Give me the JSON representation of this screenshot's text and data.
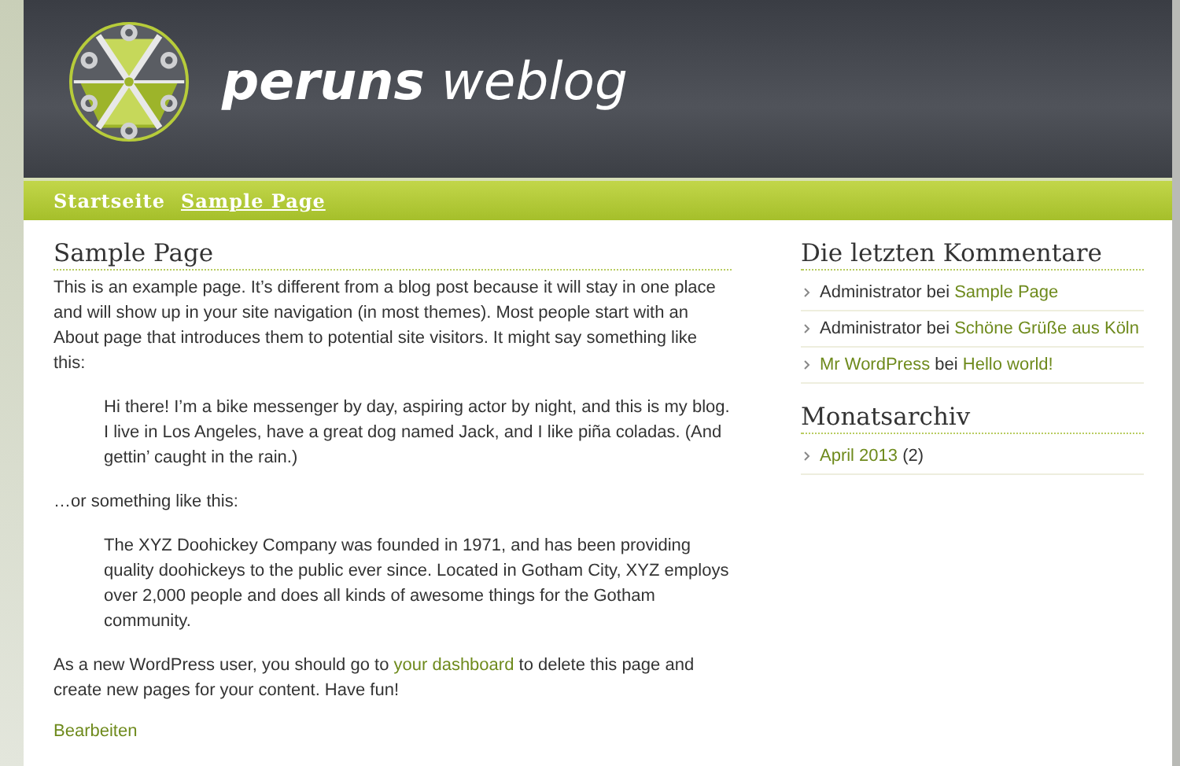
{
  "header": {
    "title_bold": "peruns",
    "title_light": "weblog"
  },
  "nav": [
    {
      "label": "Startseite",
      "selected": false
    },
    {
      "label": "Sample Page",
      "selected": true
    }
  ],
  "page": {
    "title": "Sample Page",
    "intro": "This is an example page. It’s different from a blog post because it will stay in one place and will show up in your site navigation (in most themes). Most people start with an About page that introduces them to potential site visitors. It might say something like this:",
    "quote_1": "Hi there! I’m a bike messenger by day, aspiring actor by night, and this is my blog. I live in Los Angeles, have a great dog named Jack, and I like piña coladas. (And gettin’ caught in the rain.)",
    "middle": "…or something like this:",
    "quote_2": "The XYZ Doohickey Company was founded in 1971, and has been providing quality doohickeys to the public ever since. Located in Gotham City, XYZ employs over 2,000 people and does all kinds of awesome things for the Gotham community.",
    "outro_before": "As a new WordPress user, you should go to",
    "outro_link": "your dashboard",
    "outro_after": "to delete this page and create new pages for your content. Have fun!",
    "edit_link": "Bearbeiten"
  },
  "sidebar": {
    "comments_title": "Die letzten Kommentare",
    "comments": [
      {
        "author": "Administrator",
        "author_is_link": false,
        "word": "bei",
        "post": "Sample Page"
      },
      {
        "author": "Administrator",
        "author_is_link": false,
        "word": "bei",
        "post": "Schöne Grüße aus Köln"
      },
      {
        "author": "Mr WordPress",
        "author_is_link": true,
        "word": "bei",
        "post": "Hello world!"
      }
    ],
    "archive_title": "Monatsarchiv",
    "archive": [
      {
        "label": "April 2013",
        "count": "(2)"
      }
    ]
  }
}
